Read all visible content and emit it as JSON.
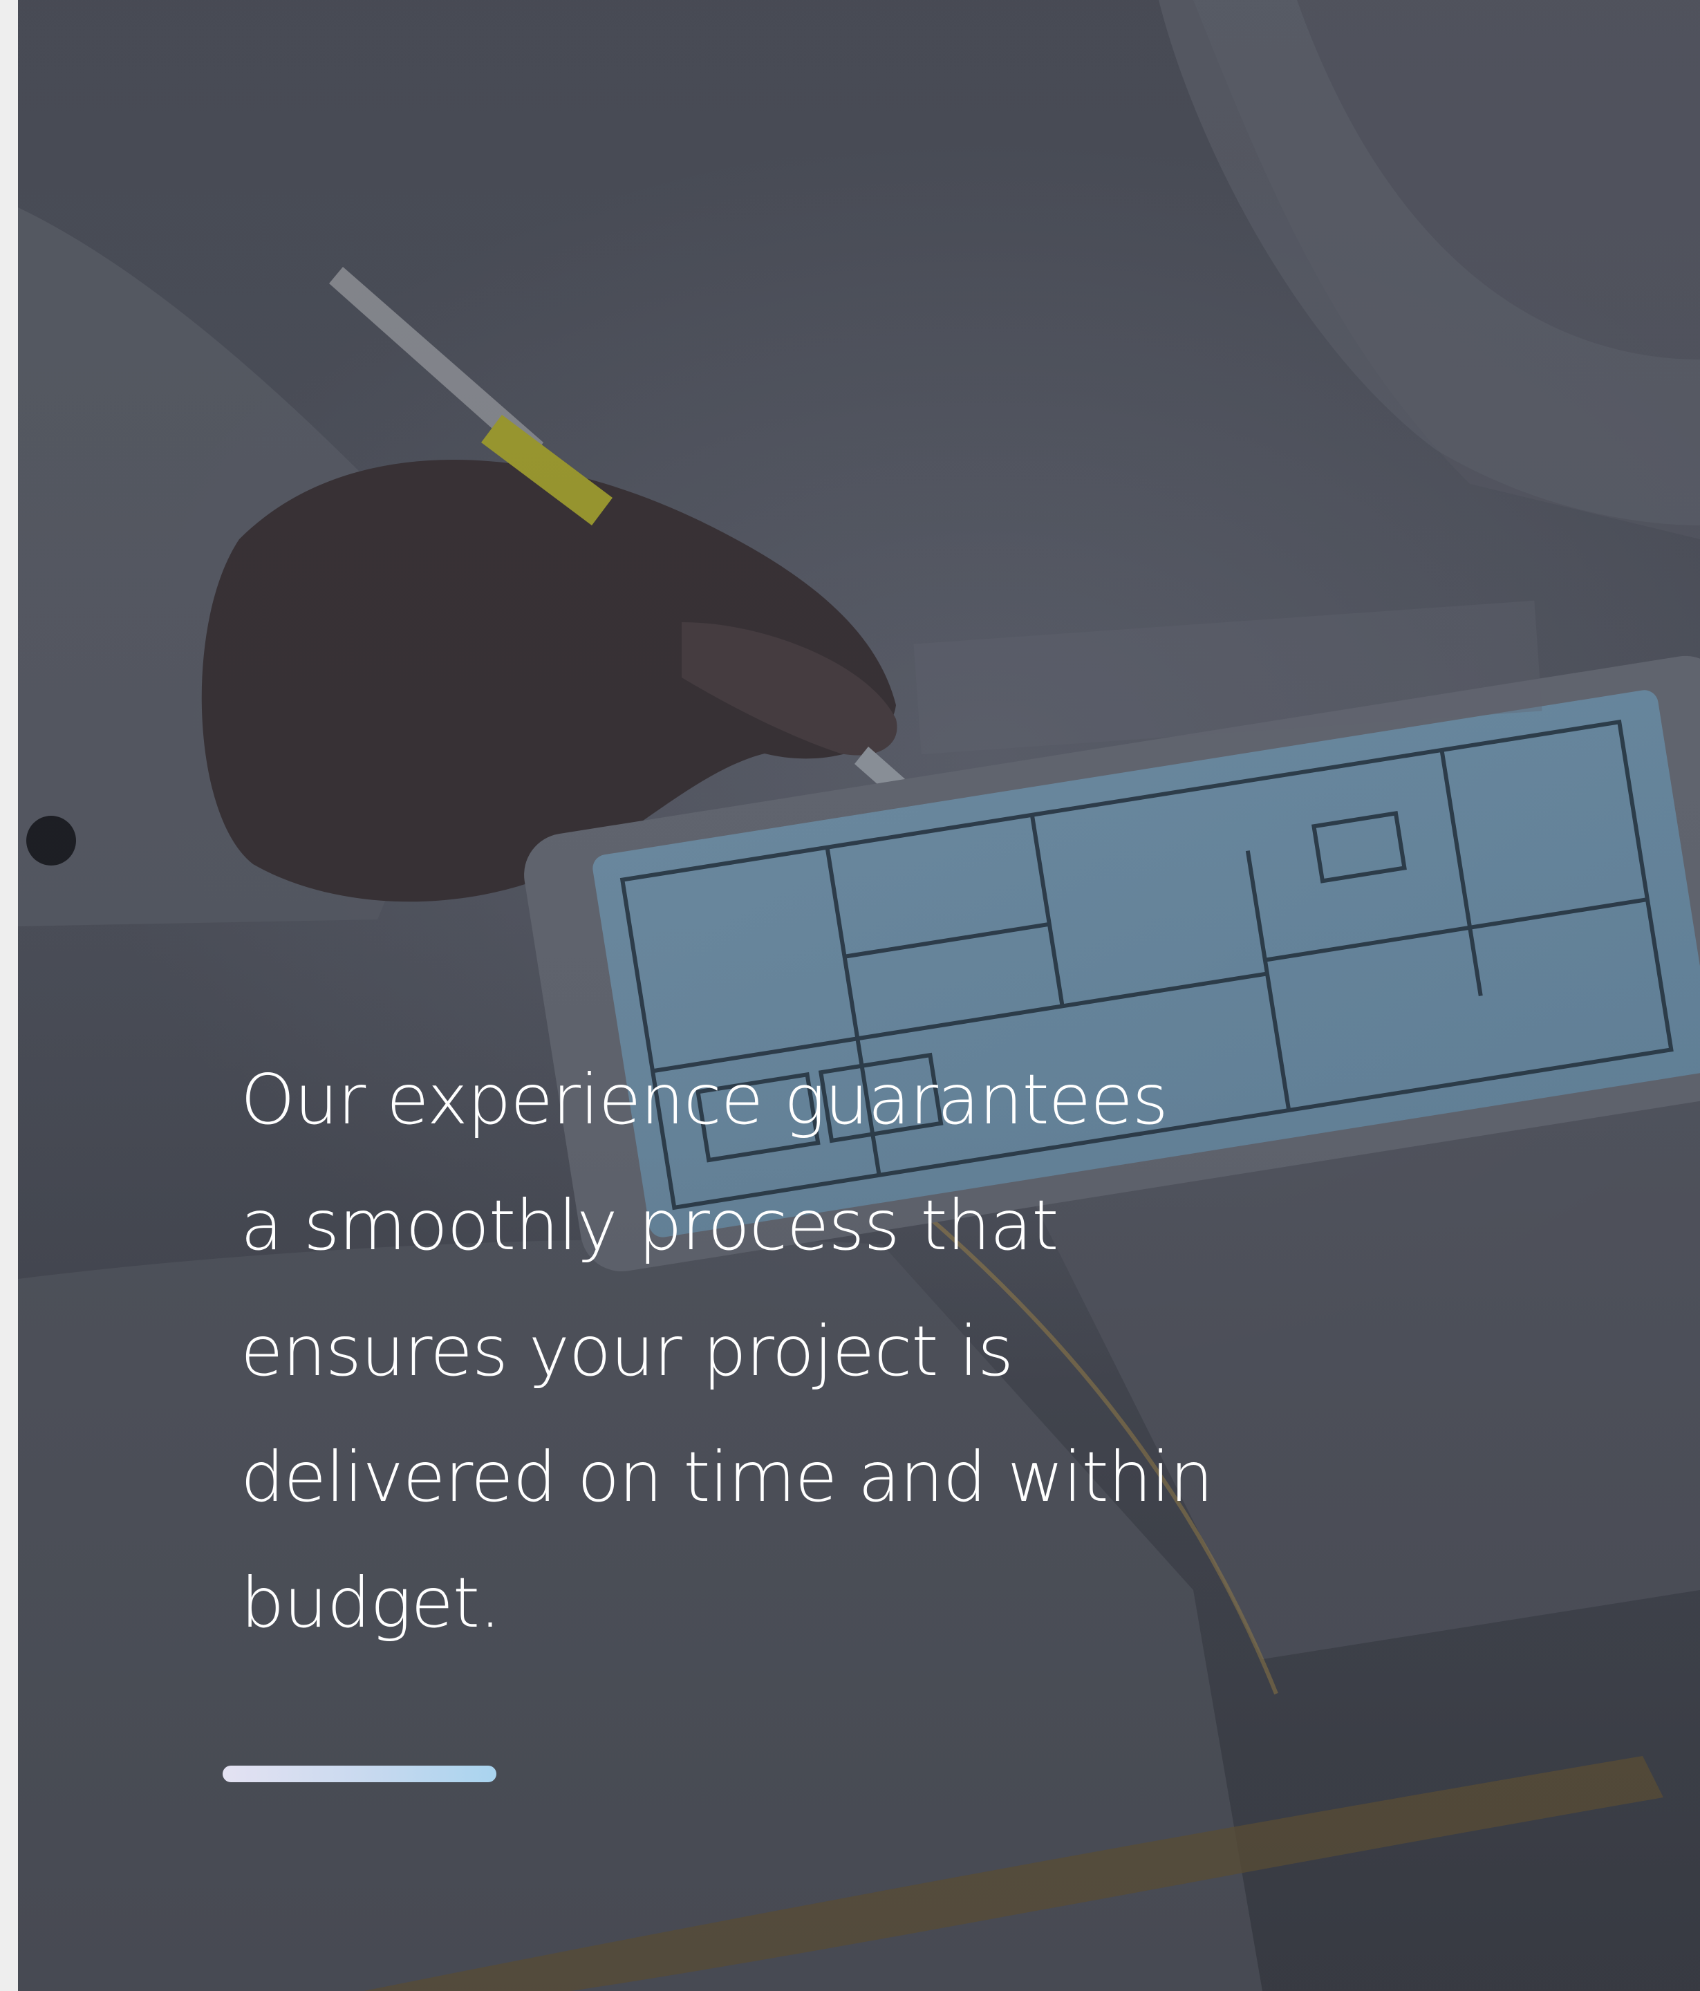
{
  "hero": {
    "statement": "Our experience guarantees\na smoothly process that\nensures your project is\ndelivered on time and within\nbudget.",
    "background_image": "architect-stylus-tablet-floor-plan-photo",
    "overlay_color": "#3c3f46",
    "accent_gradient": [
      "#e4e2f2",
      "#a9d4ef"
    ]
  }
}
